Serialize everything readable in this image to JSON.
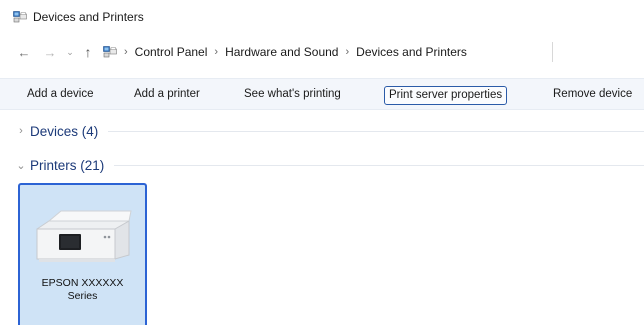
{
  "window": {
    "title": "Devices and Printers",
    "icon": "devices-printers-icon"
  },
  "address": {
    "back_icon": "back-arrow-icon",
    "forward_icon": "forward-arrow-icon",
    "recent_icon": "chevron-down-icon",
    "up_icon": "up-arrow-icon",
    "breadcrumbs": [
      "Control Panel",
      "Hardware and Sound",
      "Devices and Printers"
    ]
  },
  "toolbar": {
    "add_device": "Add a device",
    "add_printer": "Add a printer",
    "see_printing": "See what's printing",
    "print_server": "Print server properties",
    "remove_device": "Remove device"
  },
  "groups": {
    "devices": {
      "label": "Devices (4)",
      "expanded": false
    },
    "printers": {
      "label": "Printers (21)",
      "expanded": true
    }
  },
  "printers": [
    {
      "name": "EPSON XXXXXX",
      "name_line2": "Series",
      "selected": true,
      "icon": "printer-icon"
    }
  ],
  "colors": {
    "accent": "#2c63d4",
    "selection_fill": "#cfe3f6",
    "group_header": "#1c3a79",
    "toolbar_bg": "#f3f6fb"
  }
}
